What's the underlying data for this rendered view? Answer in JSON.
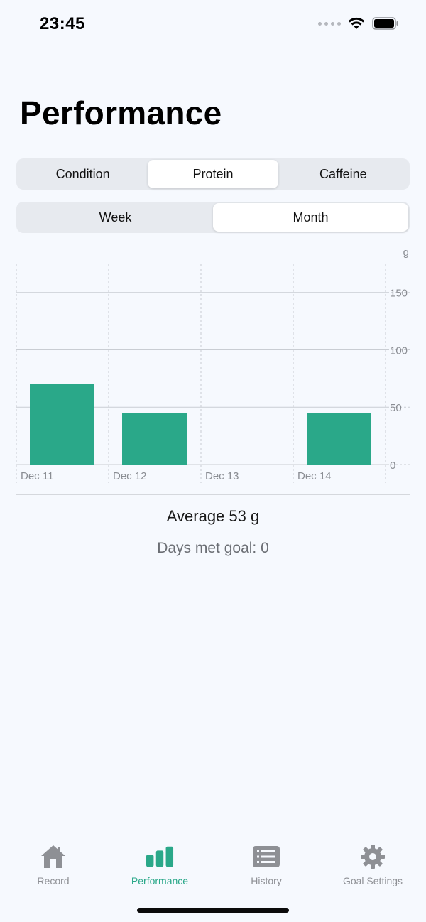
{
  "status_bar": {
    "time": "23:45"
  },
  "page": {
    "title": "Performance"
  },
  "metric_tabs": [
    {
      "label": "Condition",
      "selected": false
    },
    {
      "label": "Protein",
      "selected": true
    },
    {
      "label": "Caffeine",
      "selected": false
    }
  ],
  "period_tabs": [
    {
      "label": "Week",
      "selected": false
    },
    {
      "label": "Month",
      "selected": true
    }
  ],
  "summary": {
    "average": "Average 53 g",
    "days_met": "Days met goal: 0"
  },
  "chart_data": {
    "type": "bar",
    "categories": [
      "Dec 11",
      "Dec 12",
      "Dec 13",
      "Dec 14"
    ],
    "values": [
      70,
      45,
      0,
      45
    ],
    "ylabel": "g",
    "yticks": [
      0,
      50,
      100,
      150
    ],
    "ylim": [
      0,
      182
    ],
    "grid": true,
    "bar_color": "#2aa889"
  },
  "tab_bar": [
    {
      "label": "Record",
      "icon": "house-icon",
      "active": false
    },
    {
      "label": "Performance",
      "icon": "bar-chart-icon",
      "active": true
    },
    {
      "label": "History",
      "icon": "list-icon",
      "active": false
    },
    {
      "label": "Goal Settings",
      "icon": "gear-icon",
      "active": false
    }
  ],
  "colors": {
    "accent": "#2aa889",
    "inactive": "#8e9095",
    "background": "#f6f9fe"
  }
}
